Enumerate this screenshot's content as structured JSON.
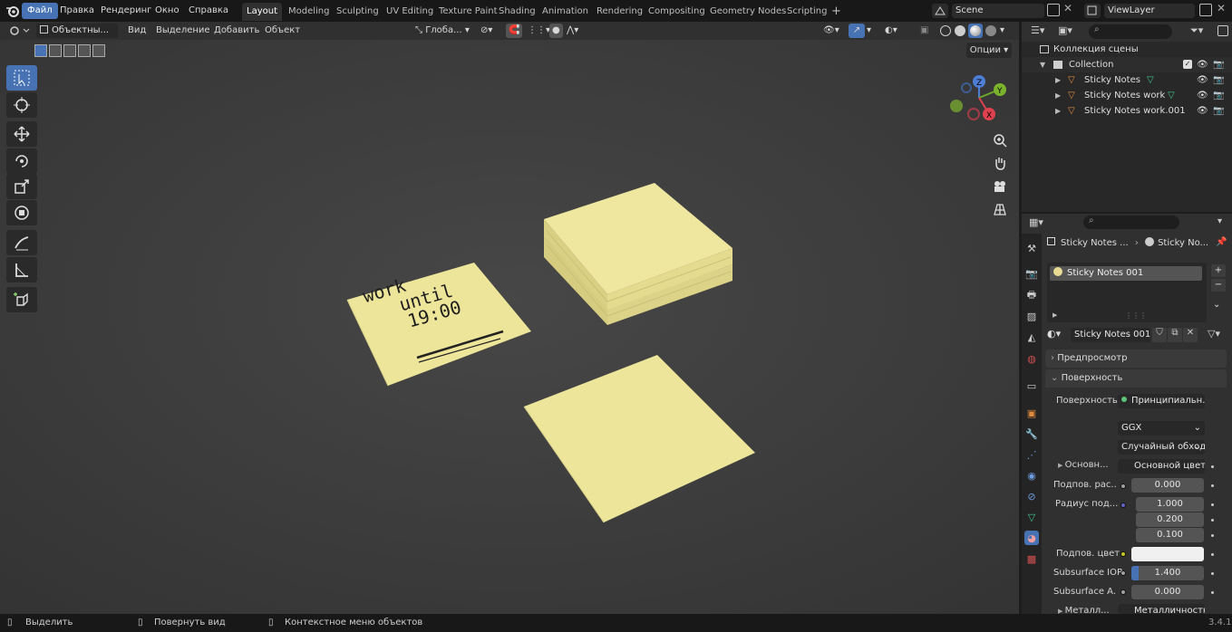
{
  "top_menu": [
    "Файл",
    "Правка",
    "Рендеринг",
    "Окно",
    "Справка"
  ],
  "workspaces": [
    "Layout",
    "Modeling",
    "Sculpting",
    "UV Editing",
    "Texture Paint",
    "Shading",
    "Animation",
    "Rendering",
    "Compositing",
    "Geometry Nodes",
    "Scripting"
  ],
  "add_workspace": "+",
  "scene_name": "Scene",
  "view_layer": "ViewLayer",
  "viewport_header": {
    "mode": "Объектны...",
    "menus": [
      "Вид",
      "Выделение",
      "Добавить",
      "Объект"
    ],
    "transform_orientation": "Глоба...",
    "options": "Опции"
  },
  "note_text": {
    "line1": "work",
    "line2": "until",
    "line3": "19:00"
  },
  "outliner": {
    "scene_collection": "Коллекция сцены",
    "collection": "Collection",
    "objects": [
      "Sticky Notes",
      "Sticky Notes work",
      "Sticky Notes work.001"
    ]
  },
  "properties": {
    "breadcrumb_object": "Sticky Notes ...",
    "breadcrumb_material": "Sticky No...",
    "slot_name": "Sticky Notes 001",
    "material_name": "Sticky Notes 001",
    "panel_preview": "Предпросмотр",
    "panel_surface": "Поверхность",
    "surface_label": "Поверхность",
    "surface_value": "Принципиальн...",
    "distribution": "GGX",
    "subsurface_method": "Случайный обход",
    "base_color_label": "Основн...",
    "base_color_value": "Основной цвет",
    "subsurface_label": "Подпов. рас...",
    "subsurface_value": "0.000",
    "radius_label": "Радиус под...",
    "radius_values": [
      "1.000",
      "0.200",
      "0.100"
    ],
    "subsurface_color_label": "Подпов. цвет",
    "subsurface_color": "#f0f0f0",
    "ior_label": "Subsurface IOR",
    "ior_value": "1.400",
    "aniso_label": "Subsurface A...",
    "aniso_value": "0.000",
    "metallic_label": "Металл...",
    "metallic_value": "Металличность"
  },
  "statusbar": {
    "select": "Выделить",
    "rotate": "Повернуть вид",
    "context": "Контекстное меню объектов",
    "version": "3.4.1"
  },
  "colors": {
    "accent": "#4772b3",
    "note": "#ece59a",
    "viewport_bg": "#3c3c3c"
  },
  "icons": [
    "blender-logo-icon",
    "select-box-icon",
    "cursor-icon",
    "move-icon",
    "rotate-icon",
    "scale-icon",
    "transform-icon",
    "annotate-icon",
    "measure-icon",
    "add-cube-icon",
    "zoom-icon",
    "hand-icon",
    "camera-icon",
    "grid-icon",
    "eye-icon",
    "camera-render-icon",
    "mesh-data-icon",
    "material-icon"
  ]
}
